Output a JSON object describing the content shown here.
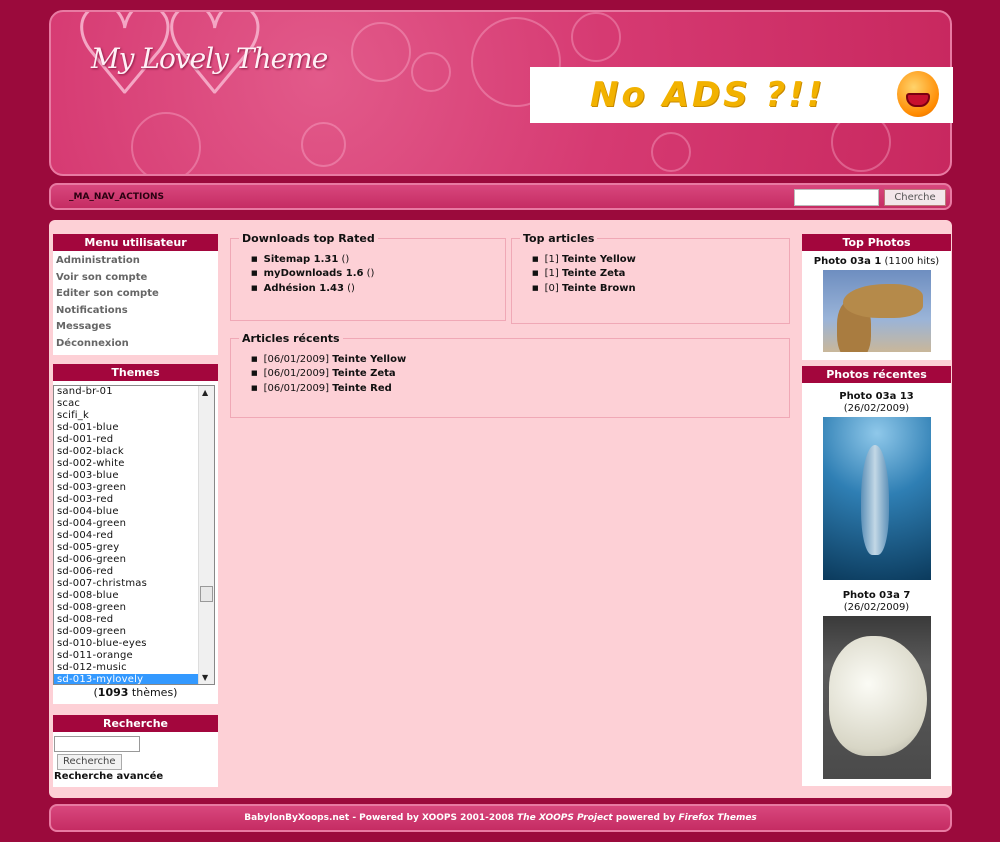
{
  "header": {
    "logo_text": "My Lovely Theme",
    "ad_text": "No ADS ?!!"
  },
  "nav": {
    "actions_label": "_MA_NAV_ACTIONS",
    "search_value": "",
    "search_button": "Cherche"
  },
  "left": {
    "user_menu": {
      "title": "Menu utilisateur",
      "items": [
        "Administration",
        "Voir son compte",
        "Editer son compte",
        "Notifications",
        "Messages",
        "Déconnexion"
      ]
    },
    "themes": {
      "title": "Themes",
      "options": [
        "sand-br-01",
        "scac",
        "scifi_k",
        "sd-001-blue",
        "sd-001-red",
        "sd-002-black",
        "sd-002-white",
        "sd-003-blue",
        "sd-003-green",
        "sd-003-red",
        "sd-004-blue",
        "sd-004-green",
        "sd-004-red",
        "sd-005-grey",
        "sd-006-green",
        "sd-006-red",
        "sd-007-christmas",
        "sd-008-blue",
        "sd-008-green",
        "sd-008-red",
        "sd-009-green",
        "sd-010-blue-eyes",
        "sd-011-orange",
        "sd-012-music",
        "sd-013-mylovely"
      ],
      "selected": "sd-013-mylovely",
      "count_prefix": "(",
      "count": "1093",
      "count_suffix": " thèmes)"
    },
    "search": {
      "title": "Recherche",
      "input_value": "",
      "button": "Recherche",
      "advanced": "Recherche avancée"
    }
  },
  "center": {
    "downloads": {
      "title": "Downloads top Rated",
      "items": [
        {
          "name": "Sitemap 1.31",
          "suffix": " ()"
        },
        {
          "name": "myDownloads 1.6",
          "suffix": " ()"
        },
        {
          "name": "Adhésion 1.43",
          "suffix": " ()"
        }
      ]
    },
    "top_articles": {
      "title": "Top articles",
      "items": [
        {
          "prefix": "[1] ",
          "name": "Teinte Yellow"
        },
        {
          "prefix": "[1] ",
          "name": "Teinte Zeta"
        },
        {
          "prefix": "[0] ",
          "name": "Teinte Brown"
        }
      ]
    },
    "recent_articles": {
      "title": "Articles récents",
      "items": [
        {
          "prefix": "[06/01/2009] ",
          "name": "Teinte Yellow"
        },
        {
          "prefix": "[06/01/2009] ",
          "name": "Teinte Zeta"
        },
        {
          "prefix": "[06/01/2009] ",
          "name": "Teinte Red"
        }
      ]
    }
  },
  "right": {
    "top_photos": {
      "title": "Top Photos",
      "photo_name": "Photo 03a 1",
      "photo_info": " (1100 hits)"
    },
    "recent_photos": {
      "title": "Photos récentes",
      "photos": [
        {
          "name": "Photo 03a 13",
          "info": " (26/02/2009)"
        },
        {
          "name": "Photo 03a 7",
          "info": " (26/02/2009)"
        }
      ]
    }
  },
  "footer": {
    "text_main": "BabylonByXoops.net - Powered by XOOPS 2001-2008 ",
    "text_italic1": "The XOOPS Project",
    "text_mid": " powered by ",
    "text_italic2": "Firefox Themes"
  },
  "colors": {
    "page_bg": "#9b0a3c",
    "header_pink": "#d63a72",
    "content_bg": "#fdd0d6",
    "block_title_bg": "#a3063d",
    "selected_option": "#3399ff"
  }
}
